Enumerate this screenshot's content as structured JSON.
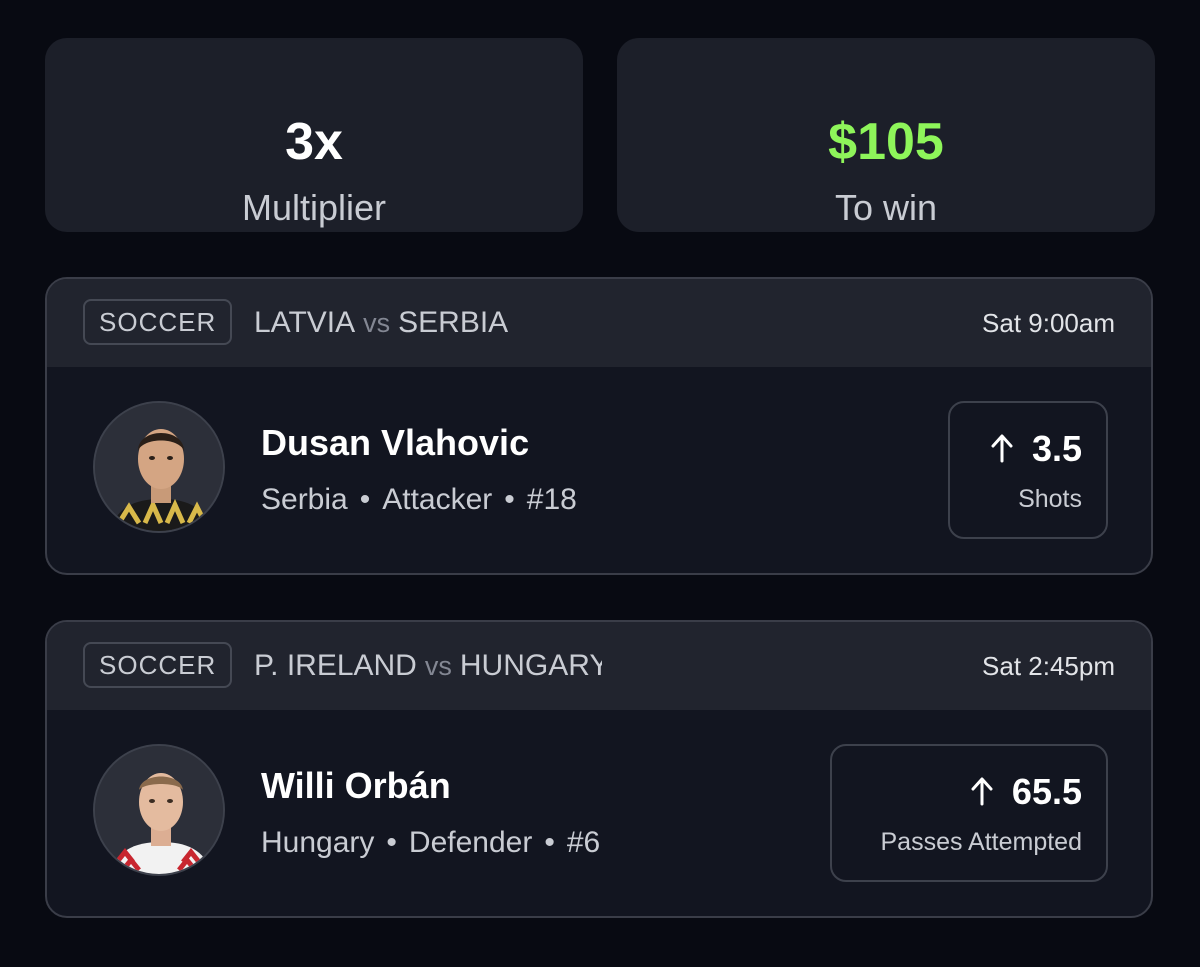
{
  "summary": {
    "multiplier_value": "3x",
    "multiplier_label": "Multiplier",
    "payout_value": "$105",
    "payout_label": "To win"
  },
  "picks": [
    {
      "sport": "SOCCER",
      "team_a": "LATVIA",
      "vs": "vs",
      "team_b": "SERBIA",
      "time": "Sat 9:00am",
      "player": {
        "name": "Dusan Vlahovic",
        "team": "Serbia",
        "position": "Attacker",
        "number": "#18"
      },
      "line": "3.5",
      "stat": "Shots",
      "direction": "up-arrow-icon"
    },
    {
      "sport": "SOCCER",
      "team_a": "P. IRELAND",
      "vs": "vs",
      "team_b": "HUNGARY",
      "time": "Sat 2:45pm",
      "player": {
        "name": "Willi Orbán",
        "team": "Hungary",
        "position": "Defender",
        "number": "#6"
      },
      "line": "65.5",
      "stat": "Passes Attempted",
      "direction": "up-arrow-icon"
    }
  ],
  "colors": {
    "background": "#080a12",
    "card": "#1c1f29",
    "accent_green": "#8ef55a"
  }
}
